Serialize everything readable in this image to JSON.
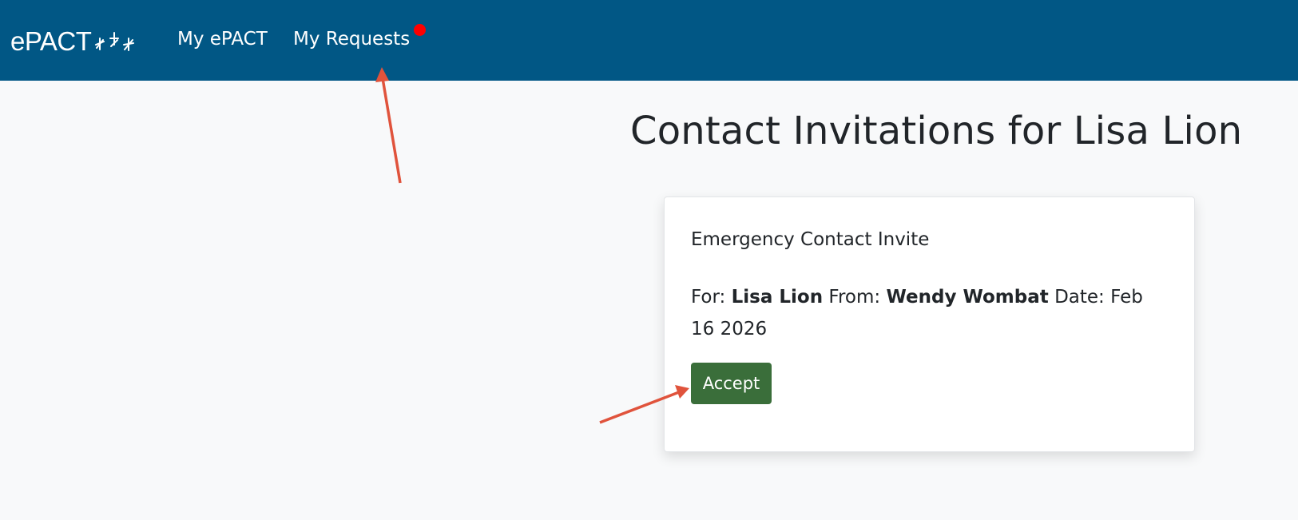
{
  "navbar": {
    "brand": "ePACT",
    "brand_icon": "stars-logo-icon",
    "links": [
      {
        "label": "My ePACT"
      },
      {
        "label": "My Requests",
        "has_notification": true
      }
    ],
    "background_color": "#015785",
    "notification_color": "#ff0000"
  },
  "page": {
    "title": "Contact Invitations for Lisa Lion"
  },
  "invite_card": {
    "title": "Emergency Contact Invite",
    "for_label": "For:",
    "for_value": "Lisa Lion",
    "from_label": "From:",
    "from_value": "Wendy Wombat",
    "date_label": "Date:",
    "date_value": "Feb 16 2026",
    "accept_label": "Accept",
    "accept_color": "#3a6e3a"
  },
  "annotations": {
    "arrow_color": "#e0533c",
    "arrows": [
      "arrow-to-my-requests",
      "arrow-to-accept-button"
    ]
  }
}
